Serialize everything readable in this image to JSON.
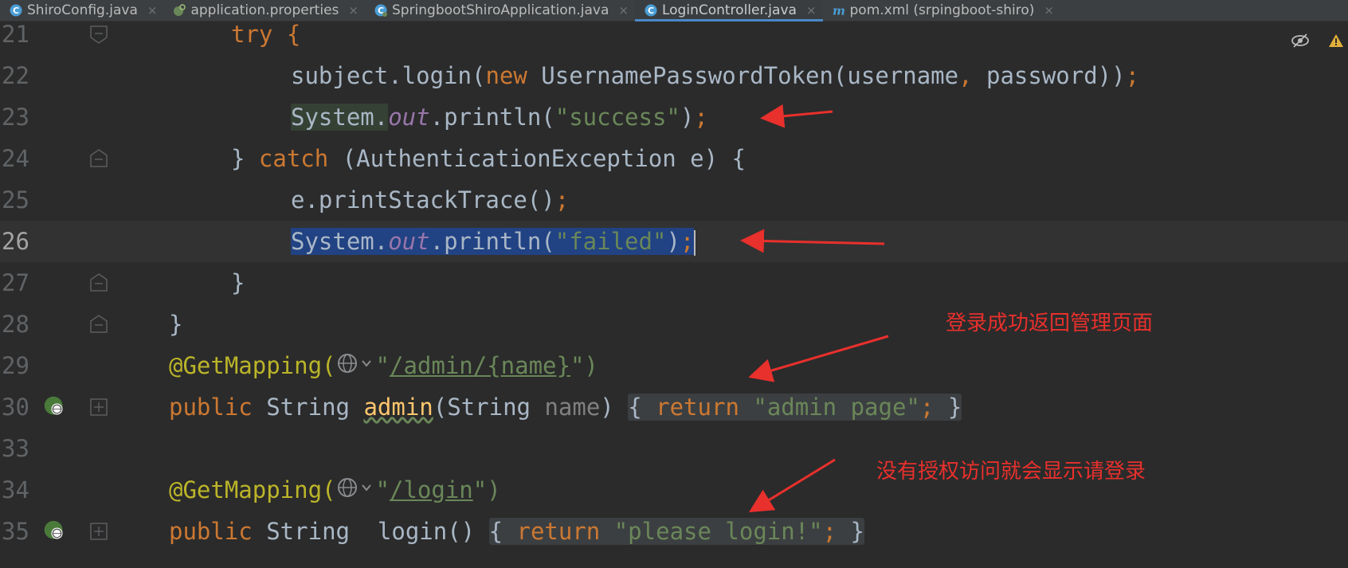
{
  "tabs": [
    {
      "label": "ShiroConfig.java",
      "icon": "java-class-icon",
      "active": false
    },
    {
      "label": "application.properties",
      "icon": "spring-properties-icon",
      "active": false
    },
    {
      "label": "SpringbootShiroApplication.java",
      "icon": "spring-boot-class-icon",
      "active": false
    },
    {
      "label": "LoginController.java",
      "icon": "java-class-icon",
      "active": true
    },
    {
      "label": "pom.xml (srpingboot-shiro)",
      "icon": "maven-icon",
      "active": false
    }
  ],
  "tab_close": "×",
  "editor": {
    "lines": [
      {
        "num": "21"
      },
      {
        "num": "22"
      },
      {
        "num": "23"
      },
      {
        "num": "24"
      },
      {
        "num": "25"
      },
      {
        "num": "26"
      },
      {
        "num": "27"
      },
      {
        "num": "28"
      },
      {
        "num": "29"
      },
      {
        "num": "30"
      },
      {
        "num": "33"
      },
      {
        "num": "34"
      },
      {
        "num": "35"
      }
    ],
    "code": {
      "l21_try": "try {",
      "l22_a": "subject.login(",
      "l22_new": "new",
      "l22_b": " UsernamePasswordToken(username",
      "l22_comma": ",",
      "l22_c": " password))",
      "l22_semi": ";",
      "l23_sys": "System.",
      "l23_out": "out",
      "l23_print": ".println(",
      "l23_str": "\"success\"",
      "l23_close": ")",
      "l23_semi": ";",
      "l24_a": "} ",
      "l24_catch": "catch",
      "l24_b": " (AuthenticationException e) {",
      "l25_a": "e.printStackTrace()",
      "l25_semi": ";",
      "l26_sys": "System.",
      "l26_out": "out",
      "l26_print": ".println(",
      "l26_str": "\"failed\"",
      "l26_close": ")",
      "l26_semi": ";",
      "l27": "}",
      "l28": "}",
      "l29_ann": "@GetMapping(",
      "l29_q1": "\"",
      "l29_path": "/admin/{name}",
      "l29_q2": "\")",
      "l30_public": "public",
      "l30_type": " String ",
      "l30_name": "admin",
      "l30_open": "(String ",
      "l30_param": "name",
      "l30_close": ") ",
      "l30_lb": "{ ",
      "l30_return": "return",
      "l30_str": " \"admin page\"",
      "l30_semi": ";",
      "l30_rb": " }",
      "l34_ann": "@GetMapping(",
      "l34_q1": "\"",
      "l34_path": "/login",
      "l34_q2": "\")",
      "l35_public": "public",
      "l35_type": " String  login() ",
      "l35_lb": "{ ",
      "l35_return": "return",
      "l35_str": " \"please login!\"",
      "l35_semi": ";",
      "l35_rb": " }"
    }
  },
  "annotations": {
    "admin_note": "登录成功返回管理页面",
    "login_note": "没有授权访问就会显示请登录"
  },
  "colors": {
    "keyword": "#cc7832",
    "string": "#6a8759",
    "annotation": "#bbb529",
    "field": "#9876aa",
    "selection": "#214283",
    "arrow": "#e8302c"
  }
}
